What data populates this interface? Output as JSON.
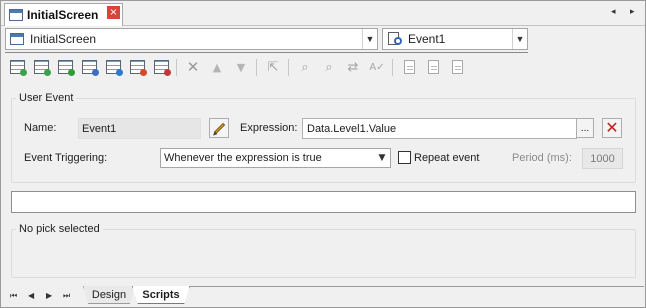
{
  "document_tab": {
    "title": "InitialScreen",
    "close": "×"
  },
  "tab_nav": {
    "left": "◂",
    "right": "▸"
  },
  "screen_selector": {
    "value": "InitialScreen"
  },
  "event_selector": {
    "value": "Event1"
  },
  "toolbar": {
    "icons": [
      "new-event-icon",
      "new-event-2-icon",
      "new-event-3-icon",
      "new-event-4-icon",
      "download-event-icon",
      "linked-event-icon",
      "print-event-icon",
      "delete-icon",
      "move-up-icon",
      "move-down-icon",
      "cursor-select-icon",
      "find-icon",
      "find-next-icon",
      "replace-icon",
      "spell-check-icon",
      "doc-1-icon",
      "doc-2-icon",
      "doc-3-icon"
    ]
  },
  "user_event": {
    "title": "User Event",
    "name_label": "Name:",
    "name_value": "Event1",
    "expression_label": "Expression:",
    "expression_value": "Data.Level1.Value",
    "browse_label": "...",
    "triggering_label": "Event Triggering:",
    "triggering_value": "Whenever the expression is true",
    "repeat_label": "Repeat event",
    "repeat_checked": false,
    "period_label": "Period (ms):",
    "period_value": "1000"
  },
  "pick_group": {
    "title": "No pick selected"
  },
  "bottom_tabs": {
    "nav": [
      "⏮",
      "◀",
      "▶",
      "⏭"
    ],
    "tabs": [
      "Design",
      "Scripts"
    ],
    "active": "Scripts"
  }
}
